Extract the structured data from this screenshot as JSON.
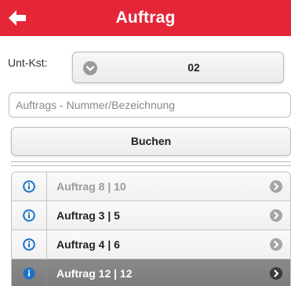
{
  "header": {
    "title": "Auftrag",
    "back_icon": "arrow-left-icon",
    "color": "#e42638"
  },
  "cost_center": {
    "label": "Unt-Kst:",
    "value": "02",
    "icon": "chevron-down-circle-icon"
  },
  "search": {
    "placeholder": "Auftrags - Nummer/Bezeichnung",
    "value": ""
  },
  "book_button": {
    "label": "Buchen"
  },
  "orders": {
    "items": [
      {
        "label": "Auftrag 8 | 10",
        "state": "dim"
      },
      {
        "label": "Auftrag 3 | 5",
        "state": "normal"
      },
      {
        "label": "Auftrag 4 | 6",
        "state": "normal"
      },
      {
        "label": "Auftrag 12 | 12",
        "state": "active"
      }
    ],
    "info_icon": "info-circle-icon",
    "chevron_icon": "chevron-right-circle-icon",
    "accent_color": "#1a73c8"
  }
}
